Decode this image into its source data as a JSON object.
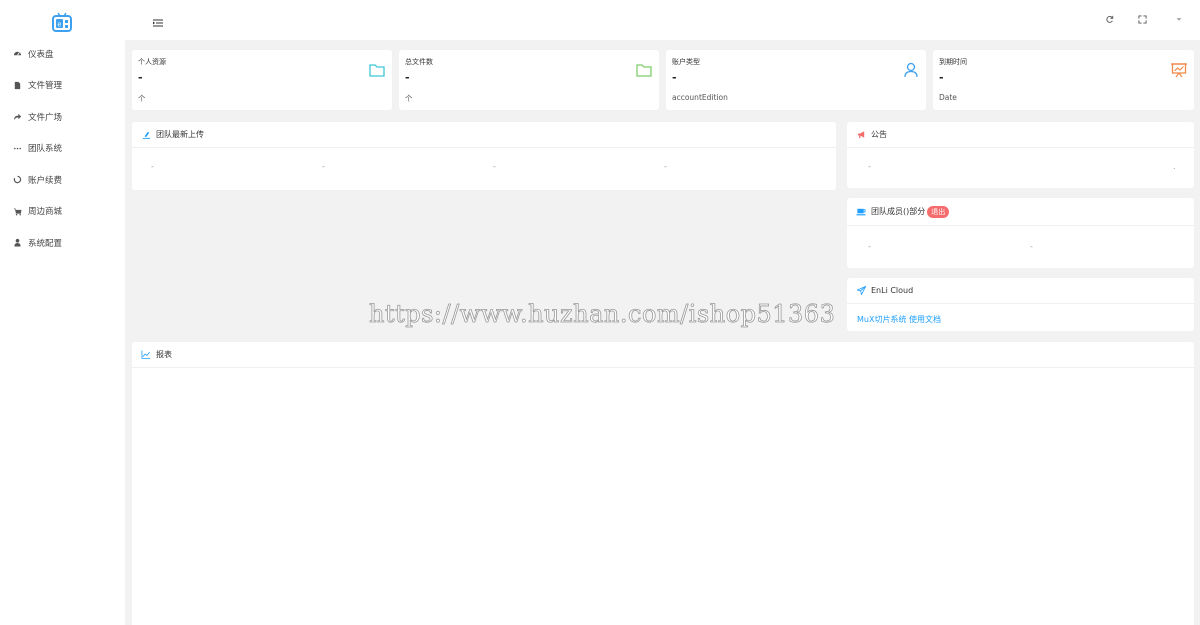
{
  "sidebar": {
    "logo_icon": "tv-logo-icon",
    "items": [
      {
        "label": "仪表盘",
        "icon": "dashboard-icon"
      },
      {
        "label": "文件管理",
        "icon": "file-icon"
      },
      {
        "label": "文件广场",
        "icon": "share-icon"
      },
      {
        "label": "团队系统",
        "icon": "ellipsis-icon"
      },
      {
        "label": "账户续费",
        "icon": "refresh-circle-icon"
      },
      {
        "label": "周边商城",
        "icon": "cart-icon"
      },
      {
        "label": "系统配置",
        "icon": "user-icon"
      }
    ]
  },
  "topbar": {
    "menu_toggle_icon": "menu-toggle-icon",
    "right_icons": [
      "refresh-icon",
      "fullscreen-icon",
      "dropdown-icon"
    ]
  },
  "stats": [
    {
      "title": "个人资源",
      "value": "-",
      "sub": "个",
      "icon": "folder-icon",
      "color": "#3ec7d4"
    },
    {
      "title": "总文件数",
      "value": "-",
      "sub": "个",
      "icon": "folder-icon",
      "color": "#7fcd6b"
    },
    {
      "title": "账户类型",
      "value": "-",
      "sub": "accountEdition",
      "icon": "user-icon",
      "color": "#3ea1f0"
    },
    {
      "title": "到期时间",
      "value": "-",
      "sub": "Date",
      "icon": "presentation-icon",
      "color": "#f08a4b"
    }
  ],
  "uploads": {
    "title": "团队最新上传",
    "items": [
      "-",
      "-",
      "-",
      "-"
    ]
  },
  "notice": {
    "title": "公告",
    "left": "-",
    "right": "."
  },
  "members": {
    "title_pre": "团队成员(",
    "title_post": ")部分",
    "badge": "退出",
    "items": [
      "-",
      "-"
    ]
  },
  "cloud": {
    "title": "EnLi Cloud",
    "link": "MuX切片系统 使用文档"
  },
  "report": {
    "title": "报表"
  },
  "watermark": "https://www.huzhan.com/ishop51363",
  "colors": {
    "accent": "#1e9fff",
    "badge": "#f56c6c",
    "background": "#f2f2f2"
  }
}
